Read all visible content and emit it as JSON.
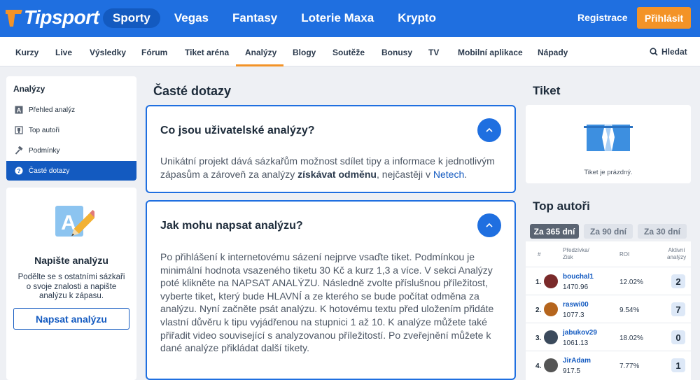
{
  "brand": {
    "name": "Tipsport",
    "accent": "#1f6fe0",
    "orange": "#f39327"
  },
  "mainnav": [
    {
      "label": "Sporty",
      "active": true
    },
    {
      "label": "Vegas"
    },
    {
      "label": "Fantasy"
    },
    {
      "label": "Loterie Maxa"
    },
    {
      "label": "Krypto"
    }
  ],
  "auth": {
    "register": "Registrace",
    "login": "Přihlásit"
  },
  "subnav": [
    {
      "label": "Kurzy"
    },
    {
      "label": "Live"
    },
    {
      "label": "Výsledky"
    },
    {
      "label": "Fórum"
    },
    {
      "label": "Tiket aréna"
    },
    {
      "label": "Analýzy",
      "active": true
    },
    {
      "label": "Blogy"
    },
    {
      "label": "Soutěže"
    },
    {
      "label": "Bonusy"
    },
    {
      "label": "TV"
    },
    {
      "label": "Mobilní aplikace"
    },
    {
      "label": "Nápady"
    }
  ],
  "search": {
    "label": "Hledat",
    "icon": "search-icon"
  },
  "sidebar": {
    "heading": "Analýzy",
    "items": [
      {
        "label": "Přehled analýz",
        "icon": "letter-a-icon"
      },
      {
        "label": "Top autoři",
        "icon": "trophy-icon"
      },
      {
        "label": "Podmínky",
        "icon": "hammer-icon"
      },
      {
        "label": "Časté dotazy",
        "icon": "question-icon",
        "active": true
      }
    ]
  },
  "write": {
    "title": "Napište analýzu",
    "text": "Podělte se s ostatními sázkaři o svoje znalosti a napište analýzu k zápasu.",
    "button": "Napsat analýzu"
  },
  "faq": {
    "title": "Časté dotazy",
    "items": [
      {
        "question": "Co jsou uživatelské analýzy?",
        "answer_a": "Unikátní projekt dává sázkařům možnost sdílet tipy a informace k jednotlivým zápasům a zároveň za analýzy ",
        "answer_bold": "získávat odměnu",
        "answer_b": ", nejčastěji v ",
        "answer_link": "Netech",
        "answer_c": "."
      },
      {
        "question": "Jak mohu napsat analýzu?",
        "answer": "Po přihlášení k internetovému sázení nejprve vsaďte tiket. Podmínkou je minimální hodnota vsazeného tiketu 30 Kč a kurz 1,3 a více. V sekci Analýzy poté klikněte na NAPSAT ANALÝZU. Následně zvolte příslušnou příležitost, vyberte tiket, který bude HLAVNÍ a ze kterého se bude počítat odměna za analýzu. Nyní začněte psát analýzu. K hotovému textu před uložením přidáte vlastní důvěru k tipu vyjádřenou na stupnici 1 až 10. K analýze můžete také přiřadit video související s analyzovanou příležitostí. Po zveřejnění můžete k dané analýze přikládat další tikety."
      }
    ]
  },
  "ticket": {
    "title": "Tiket",
    "empty": "Tiket je prázdný."
  },
  "top": {
    "title": "Top autoři",
    "filters": [
      {
        "label": "Za 365 dní",
        "active": true
      },
      {
        "label": "Za 90 dní"
      },
      {
        "label": "Za 30 dní"
      }
    ],
    "headers": {
      "rank": "#",
      "forecaster": "Předzívka/",
      "profit": "Zisk",
      "roi": "ROI",
      "active1": "Aktivní",
      "active2": "analýzy"
    },
    "rows": [
      {
        "pos": "1.",
        "name": "bouchal1",
        "points": "1470.96",
        "roi": "12.02%",
        "count": "2",
        "avatar": "#7a2a2a"
      },
      {
        "pos": "2.",
        "name": "raswi00",
        "points": "1077.3",
        "roi": "9.54%",
        "count": "7",
        "avatar": "#b5651d"
      },
      {
        "pos": "3.",
        "name": "jabukov29",
        "points": "1061.13",
        "roi": "18.02%",
        "count": "0",
        "avatar": "#3b4a5c"
      },
      {
        "pos": "4.",
        "name": "JirAdam",
        "points": "917.5",
        "roi": "7.77%",
        "count": "1",
        "avatar": "#555555"
      }
    ]
  }
}
